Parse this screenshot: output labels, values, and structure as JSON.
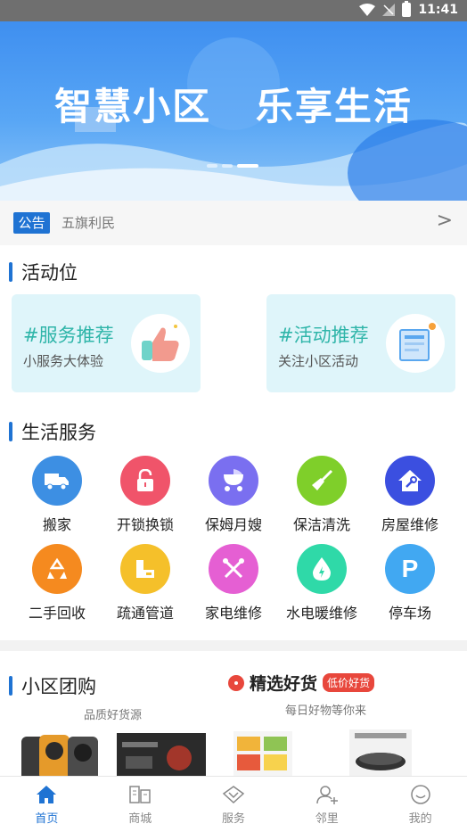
{
  "status_bar": {
    "time": "11:41"
  },
  "banner": {
    "title": "智慧小区   乐享生活"
  },
  "notice": {
    "tag": "公告",
    "text": "五旗利民",
    "arrow": ">"
  },
  "activity": {
    "title": "活动位",
    "cards": [
      {
        "title": "#服务推荐",
        "subtitle": "小服务大体验",
        "icon": "thumbs-up-icon"
      },
      {
        "title": "#活动推荐",
        "subtitle": "关注小区活动",
        "icon": "notice-board-icon"
      }
    ]
  },
  "services": {
    "title": "生活服务",
    "items": [
      {
        "label": "搬家",
        "icon": "truck-icon",
        "color": "#3d8fe3"
      },
      {
        "label": "开锁换锁",
        "icon": "lock-icon",
        "color": "#f0546a"
      },
      {
        "label": "保姆月嫂",
        "icon": "stroller-icon",
        "color": "#7a6ff0"
      },
      {
        "label": "保洁清洗",
        "icon": "broom-icon",
        "color": "#7fcf2a"
      },
      {
        "label": "房屋维修",
        "icon": "house-repair-icon",
        "color": "#3b4fe0"
      },
      {
        "label": "二手回收",
        "icon": "recycle-icon",
        "color": "#f58a1f"
      },
      {
        "label": "疏通管道",
        "icon": "pipe-icon",
        "color": "#f5c02a"
      },
      {
        "label": "家电维修",
        "icon": "tools-icon",
        "color": "#e55fd3"
      },
      {
        "label": "水电暖维修",
        "icon": "water-drop-icon",
        "color": "#2fd9a8"
      },
      {
        "label": "停车场",
        "icon": "parking-icon",
        "color": "#41a8f2"
      }
    ]
  },
  "group_buy": {
    "title": "小区团购",
    "subtitle": "品质好货源"
  },
  "selected": {
    "title": "精选好货",
    "badge": "低价好货",
    "subtitle": "每日好物等你来"
  },
  "tabs": [
    {
      "label": "首页",
      "icon": "home-icon",
      "active": true
    },
    {
      "label": "商城",
      "icon": "mall-icon",
      "active": false
    },
    {
      "label": "服务",
      "icon": "service-icon",
      "active": false
    },
    {
      "label": "邻里",
      "icon": "neighbor-icon",
      "active": false
    },
    {
      "label": "我的",
      "icon": "profile-icon",
      "active": false
    }
  ]
}
